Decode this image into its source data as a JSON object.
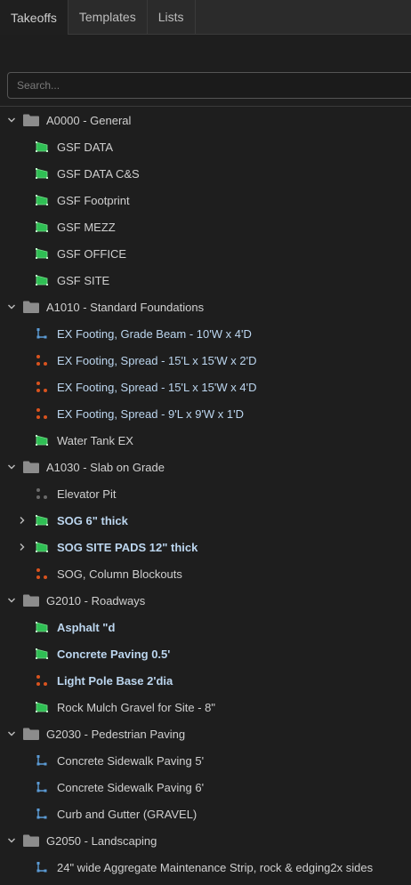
{
  "tabs": [
    {
      "label": "Takeoffs",
      "active": true
    },
    {
      "label": "Templates",
      "active": false
    },
    {
      "label": "Lists",
      "active": false
    }
  ],
  "search": {
    "placeholder": "Search...",
    "value": ""
  },
  "colors": {
    "area": "#2fbf54",
    "count": "#d9531e",
    "count_gray": "#6b6b6b",
    "linear": "#5b9bd5",
    "folder": "#8c8c8c"
  },
  "tree": [
    {
      "type": "folder",
      "label": "A0000 - General",
      "expanded": true,
      "level": 0
    },
    {
      "type": "item",
      "icon": "area",
      "label": "GSF DATA",
      "style": "plain",
      "level": 1
    },
    {
      "type": "item",
      "icon": "area",
      "label": "GSF DATA C&S",
      "style": "plain",
      "level": 1
    },
    {
      "type": "item",
      "icon": "area",
      "label": "GSF Footprint",
      "style": "plain",
      "level": 1
    },
    {
      "type": "item",
      "icon": "area",
      "label": "GSF MEZZ",
      "style": "plain",
      "level": 1
    },
    {
      "type": "item",
      "icon": "area",
      "label": "GSF OFFICE",
      "style": "plain",
      "level": 1
    },
    {
      "type": "item",
      "icon": "area",
      "label": "GSF SITE",
      "style": "plain",
      "level": 1
    },
    {
      "type": "folder",
      "label": "A1010 - Standard Foundations",
      "expanded": true,
      "level": 0
    },
    {
      "type": "item",
      "icon": "linear",
      "label": "EX Footing, Grade Beam - 10'W x 4'D",
      "style": "blue",
      "level": 1
    },
    {
      "type": "item",
      "icon": "count",
      "label": "EX Footing, Spread - 15'L x 15'W x 2'D",
      "style": "blue",
      "level": 1
    },
    {
      "type": "item",
      "icon": "count",
      "label": "EX Footing, Spread - 15'L x 15'W x 4'D",
      "style": "blue",
      "level": 1
    },
    {
      "type": "item",
      "icon": "count",
      "label": "EX Footing, Spread - 9'L x 9'W x 1'D",
      "style": "blue",
      "level": 1
    },
    {
      "type": "item",
      "icon": "area",
      "label": "Water Tank EX",
      "style": "plain",
      "level": 1
    },
    {
      "type": "folder",
      "label": "A1030 - Slab on Grade",
      "expanded": true,
      "level": 0
    },
    {
      "type": "item",
      "icon": "count_gray",
      "label": "Elevator Pit",
      "style": "plain",
      "level": 1
    },
    {
      "type": "item",
      "icon": "area",
      "label": "SOG 6\" thick",
      "style": "bluebold",
      "level": 1,
      "expandable": true
    },
    {
      "type": "item",
      "icon": "area",
      "label": "SOG SITE PADS 12\" thick",
      "style": "bluebold",
      "level": 1,
      "expandable": true
    },
    {
      "type": "item",
      "icon": "count",
      "label": "SOG, Column Blockouts",
      "style": "plain",
      "level": 1
    },
    {
      "type": "folder",
      "label": "G2010 - Roadways",
      "expanded": true,
      "level": 0
    },
    {
      "type": "item",
      "icon": "area",
      "label": "Asphalt \"d",
      "style": "bluebold",
      "level": 1
    },
    {
      "type": "item",
      "icon": "area",
      "label": "Concrete Paving 0.5'",
      "style": "bluebold",
      "level": 1
    },
    {
      "type": "item",
      "icon": "count",
      "label": "Light Pole Base 2'dia",
      "style": "bluebold",
      "level": 1
    },
    {
      "type": "item",
      "icon": "area",
      "label": "Rock Mulch Gravel for Site - 8\"",
      "style": "plain",
      "level": 1
    },
    {
      "type": "folder",
      "label": "G2030 - Pedestrian Paving",
      "expanded": true,
      "level": 0
    },
    {
      "type": "item",
      "icon": "linear",
      "label": "Concrete Sidewalk Paving 5'",
      "style": "plain",
      "level": 1
    },
    {
      "type": "item",
      "icon": "linear",
      "label": "Concrete Sidewalk Paving 6'",
      "style": "plain",
      "level": 1
    },
    {
      "type": "item",
      "icon": "linear",
      "label": "Curb and Gutter (GRAVEL)",
      "style": "plain",
      "level": 1
    },
    {
      "type": "folder",
      "label": "G2050 - Landscaping",
      "expanded": true,
      "level": 0
    },
    {
      "type": "item",
      "icon": "linear",
      "label": "24\" wide Aggregate Maintenance Strip, rock & edging2x sides",
      "style": "plain",
      "level": 1
    }
  ]
}
